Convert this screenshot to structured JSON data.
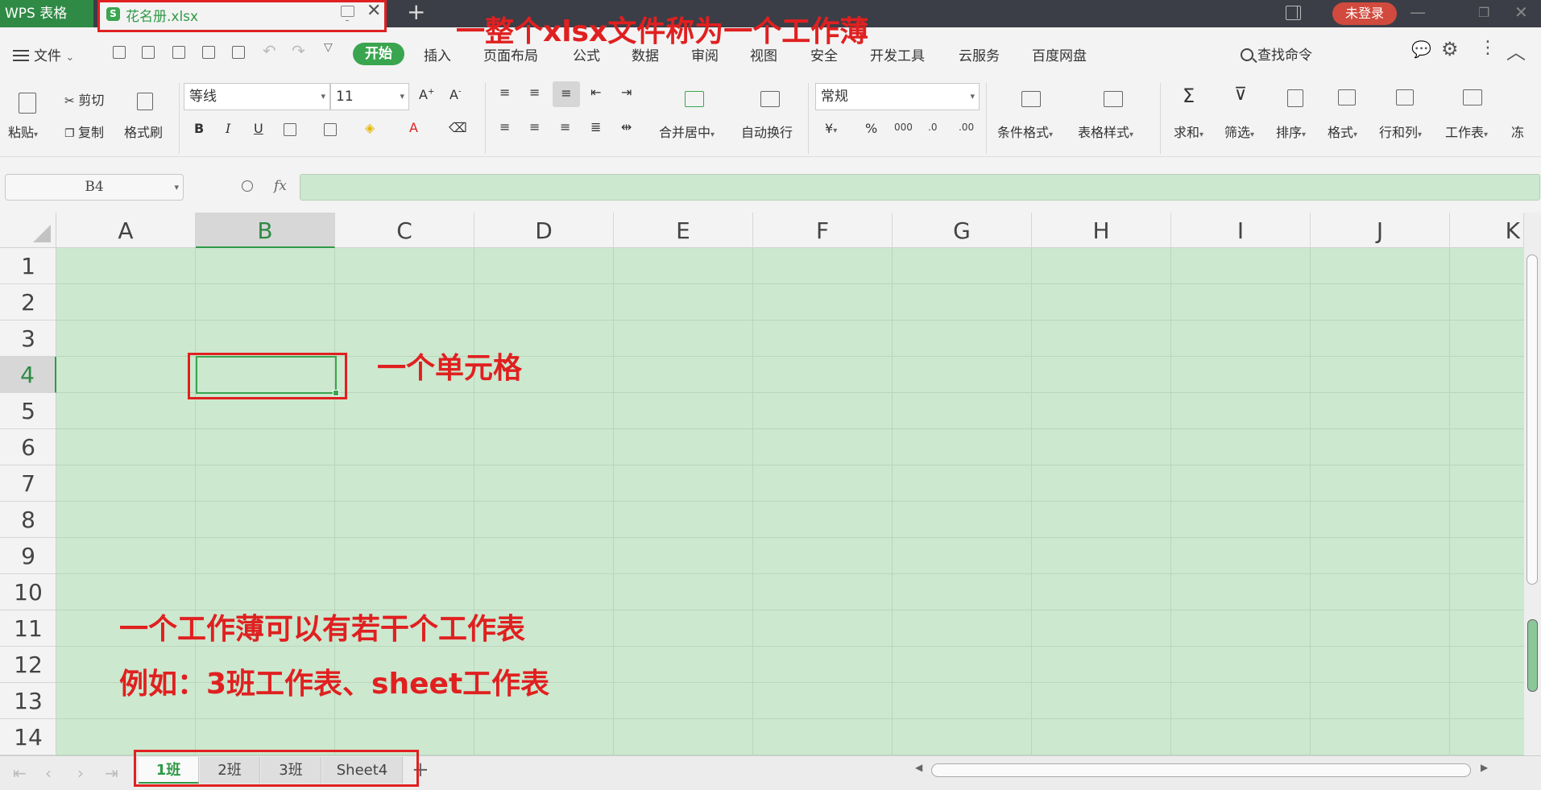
{
  "window": {
    "app_name": "WPS 表格",
    "document_tab": "花名册.xlsx",
    "login_label": "未登录",
    "new_tab_glyph": "+",
    "close_glyph": "✕"
  },
  "menu": {
    "file_label": "文件",
    "tabs": [
      "开始",
      "插入",
      "页面布局",
      "公式",
      "数据",
      "审阅",
      "视图",
      "安全",
      "开发工具",
      "云服务",
      "百度网盘"
    ],
    "search_label": "查找命令"
  },
  "ribbon": {
    "paste": "粘贴",
    "cut": "剪切",
    "copy": "复制",
    "format_painter": "格式刷",
    "font_name": "等线",
    "font_size": "11",
    "bold": "B",
    "italic": "I",
    "underline": "U",
    "merge_center": "合并居中",
    "wrap_text": "自动换行",
    "number_format": "常规",
    "percent": "%",
    "conditional_format": "条件格式",
    "table_style": "表格样式",
    "sum": "求和",
    "filter": "筛选",
    "sort": "排序",
    "format": "格式",
    "rows_cols": "行和列",
    "worksheet": "工作表",
    "more": "冻"
  },
  "formula_bar": {
    "name_box": "B4",
    "fx": "fx",
    "value": ""
  },
  "grid": {
    "columns": [
      "A",
      "B",
      "C",
      "D",
      "E",
      "F",
      "G",
      "H",
      "I",
      "J",
      "K"
    ],
    "rows": [
      "1",
      "2",
      "3",
      "4",
      "5",
      "6",
      "7",
      "8",
      "9",
      "10",
      "11",
      "12",
      "13",
      "14"
    ],
    "selected_cell": "B4",
    "cell_color": "#cce8cf",
    "accent_color": "#3aa54f"
  },
  "sheets": {
    "tabs": [
      "1班",
      "2班",
      "3班",
      "Sheet4"
    ],
    "active": "1班",
    "add_glyph": "+"
  },
  "annotations": {
    "workbook": "一整个xlsx文件称为一个工作薄",
    "cell": "一个单元格",
    "sheets_line1": "一个工作薄可以有若干个工作表",
    "sheets_line2": "例如：3班工作表、sheet工作表",
    "color": "#e02020"
  }
}
